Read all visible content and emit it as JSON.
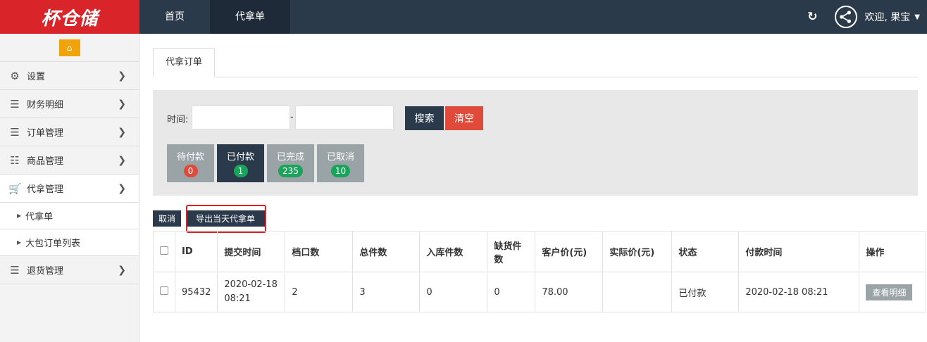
{
  "logo": {
    "text": "杯仓储"
  },
  "nav": {
    "items": [
      {
        "label": "首页"
      },
      {
        "label": "代拿单"
      }
    ]
  },
  "user": {
    "welcome": "欢迎, 果宝"
  },
  "sidebar": {
    "items": [
      {
        "label": "设置",
        "icon": "gear-icon"
      },
      {
        "label": "财务明细",
        "icon": "menu-icon"
      },
      {
        "label": "订单管理",
        "icon": "menu-icon"
      },
      {
        "label": "商品管理",
        "icon": "list-icon"
      },
      {
        "label": "代拿管理",
        "icon": "cart-icon"
      },
      {
        "label": "退货管理",
        "icon": "menu-icon"
      }
    ],
    "sub_items": [
      {
        "label": "代拿单"
      },
      {
        "label": "大包订单列表"
      }
    ]
  },
  "tab": {
    "label": "代拿订单"
  },
  "filter": {
    "time_label": "时间:",
    "dash": "-",
    "search_label": "搜索",
    "clear_label": "清空",
    "status_tabs": [
      {
        "label": "待付款",
        "count": "0"
      },
      {
        "label": "已付款",
        "count": "1"
      },
      {
        "label": "已完成",
        "count": "235"
      },
      {
        "label": "已取消",
        "count": "10"
      }
    ]
  },
  "actions": {
    "cancel_label": "取消",
    "export_label": "导出当天代拿单"
  },
  "table": {
    "headers": [
      "ID",
      "提交时间",
      "档口数",
      "总件数",
      "入库件数",
      "缺货件数",
      "客户价(元)",
      "实际价(元)",
      "状态",
      "付款时间",
      "操作"
    ],
    "rows": [
      {
        "id": "95432",
        "submit_time": "2020-02-18 08:21",
        "stalls": "2",
        "total": "3",
        "stocked": "0",
        "missing": "0",
        "customer_price": "78.00",
        "actual_price": "",
        "status": "已付款",
        "pay_time": "2020-02-18 08:21",
        "op_label": "查看明细"
      }
    ]
  },
  "colors": {
    "topbar": "#2b3a4b",
    "brand": "#d9252a",
    "danger": "#e04a3a",
    "success": "#1aa35a",
    "home": "#f0a30a"
  }
}
